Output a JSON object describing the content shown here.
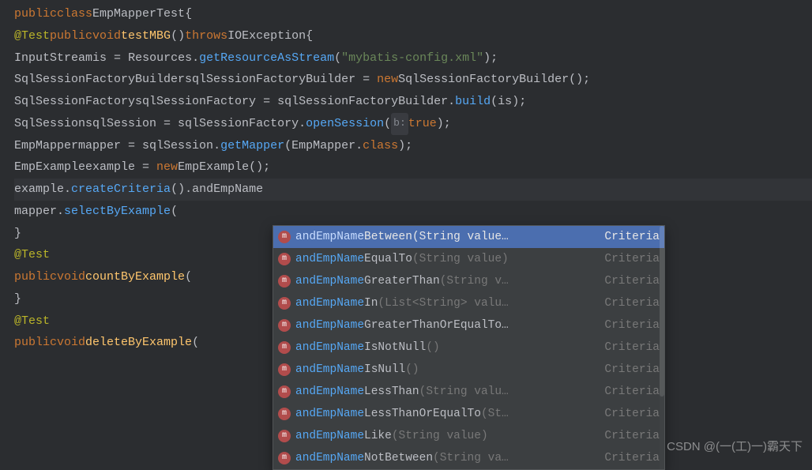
{
  "code": {
    "line1": {
      "public": "public",
      "class": "class",
      "name": "EmpMapperTest",
      "brace": "{"
    },
    "line2": {
      "ann": "@Test",
      "public": "public",
      "void": "void",
      "method": "testMBG",
      "paren": "()",
      "throws": "throws",
      "exc": "IOException",
      "brace": "{"
    },
    "line3": {
      "type": "InputStream",
      "var": "is",
      "eq": " = ",
      "cls": "Resources",
      "dot": ".",
      "m": "getResourceAsStream",
      "lp": "(",
      "str": "\"mybatis-config.xml\"",
      "rp": ");"
    },
    "line4": {
      "type": "SqlSessionFactoryBuilder",
      "var": "sqlSessionFactoryBuilder",
      "eq": " = ",
      "new": "new",
      "cls": "SqlSessionFactoryBuilder",
      "rp": "();"
    },
    "line5": {
      "type": "SqlSessionFactory",
      "var": "sqlSessionFactory",
      "eq": " = ",
      "obj": "sqlSessionFactoryBuilder",
      "dot": ".",
      "m": "build",
      "lp": "(",
      "arg": "is",
      "rp": ");"
    },
    "line6": {
      "type": "SqlSession",
      "var": "sqlSession",
      "eq": " = ",
      "obj": "sqlSessionFactory",
      "dot": ".",
      "m": "openSession",
      "lp": "(",
      "hint": "b:",
      "arg": "true",
      "rp": ");"
    },
    "line7": {
      "type": "EmpMapper",
      "var": "mapper",
      "eq": " = ",
      "obj": "sqlSession",
      "dot": ".",
      "m": "getMapper",
      "lp": "(",
      "arg": "EmpMapper",
      "dot2": ".",
      "cls2": "class",
      "rp": ");"
    },
    "line8": {
      "type": "EmpExample",
      "var": "example",
      "eq": " = ",
      "new": "new",
      "cls": "EmpExample",
      "rp": "();"
    },
    "line9": {
      "obj": "example",
      "dot": ".",
      "m": "createCriteria",
      "paren": "()",
      "dot2": ".",
      "caret": "andEmpName"
    },
    "line10": {
      "obj": "mapper",
      "dot": ".",
      "m": "selectByExample",
      "lp": "("
    },
    "line11": {
      "brace": "}"
    },
    "line12": {
      "ann": "@Test"
    },
    "line13": {
      "public": "public",
      "void": "void",
      "method": "countByExample",
      "lp": "("
    },
    "line14": {
      "brace": "}"
    },
    "line15": {
      "ann": "@Test"
    },
    "line16": {
      "public": "public",
      "void": "void",
      "method": "deleteByExample",
      "lp": "("
    }
  },
  "completion": {
    "match": "andEmpName",
    "items": [
      {
        "rest": "Between",
        "params": "(String value…",
        "ret": "Criteria"
      },
      {
        "rest": "EqualTo",
        "params": "(String value)",
        "ret": "Criteria"
      },
      {
        "rest": "GreaterThan",
        "params": "(String v…",
        "ret": "Criteria"
      },
      {
        "rest": "In",
        "params": "(List<String> valu…",
        "ret": "Criteria"
      },
      {
        "rest": "GreaterThanOrEqualTo…",
        "params": "",
        "ret": "Criteria"
      },
      {
        "rest": "IsNotNull",
        "params": "()",
        "ret": "Criteria"
      },
      {
        "rest": "IsNull",
        "params": "()",
        "ret": "Criteria"
      },
      {
        "rest": "LessThan",
        "params": "(String valu…",
        "ret": "Criteria"
      },
      {
        "rest": "LessThanOrEqualTo",
        "params": "(St…",
        "ret": "Criteria"
      },
      {
        "rest": "Like",
        "params": "(String value)",
        "ret": "Criteria"
      },
      {
        "rest": "NotBetween",
        "params": "(String va…",
        "ret": "Criteria"
      }
    ]
  },
  "watermark": "CSDN @(一(工)一)霸天下",
  "icon_glyph": "m"
}
